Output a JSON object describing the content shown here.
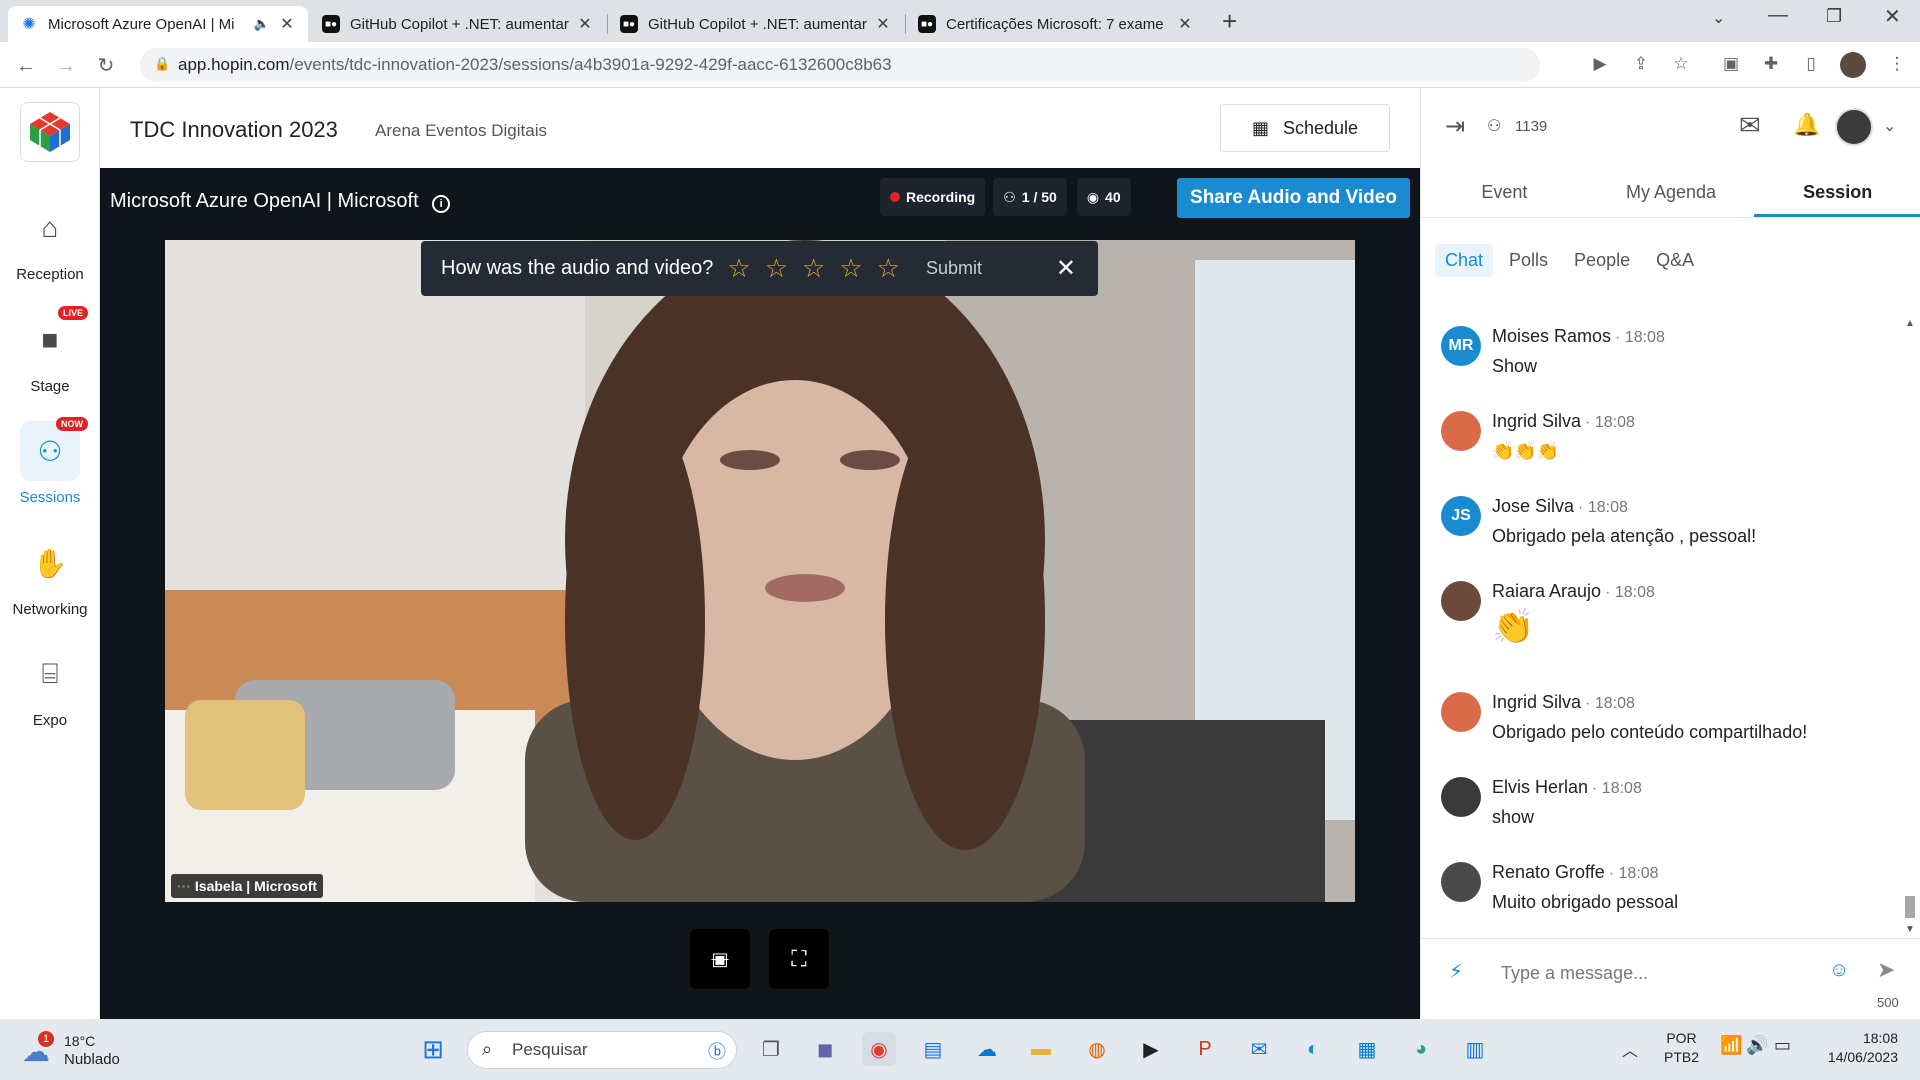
{
  "browser": {
    "tabs": [
      {
        "title": "Microsoft Azure OpenAI | Mi",
        "active": true
      },
      {
        "title": "GitHub Copilot + .NET: aumentar",
        "active": false
      },
      {
        "title": "GitHub Copilot + .NET: aumentar",
        "active": false
      },
      {
        "title": "Certificações Microsoft: 7 exame",
        "active": false
      }
    ],
    "url_host": "app.hopin.com",
    "url_path": "/events/tdc-innovation-2023/sessions/a4b3901a-9292-429f-aacc-6132600c8b63",
    "new_tab_label": "+"
  },
  "nav": {
    "items": [
      {
        "label": "Reception",
        "icon": "home-icon"
      },
      {
        "label": "Stage",
        "icon": "camera-icon",
        "badge": "LIVE"
      },
      {
        "label": "Sessions",
        "icon": "people-icon",
        "badge": "NOW"
      },
      {
        "label": "Networking",
        "icon": "handshake-icon"
      },
      {
        "label": "Expo",
        "icon": "store-icon"
      }
    ]
  },
  "header": {
    "event_title": "TDC Innovation 2023",
    "organizer": "Arena Eventos Digitais",
    "schedule_label": "Schedule"
  },
  "stage": {
    "session_title": "Microsoft Azure OpenAI | Microsoft",
    "recording_label": "Recording",
    "participants": "1 / 50",
    "viewers": "40",
    "share_label": "Share Audio and Video",
    "speaker_name": "Isabela | Microsoft",
    "rating": {
      "question": "How was the audio and video?",
      "stars": 5,
      "submit_label": "Submit"
    }
  },
  "panel": {
    "attendee_count": "1139",
    "main_tabs": [
      "Event",
      "My Agenda",
      "Session"
    ],
    "active_main_tab": "Session",
    "sub_tabs": [
      "Chat",
      "Polls",
      "People",
      "Q&A"
    ],
    "active_sub_tab": "Chat",
    "messages": [
      {
        "name": "Moises Ramos",
        "time": "· 18:08",
        "text": "Show",
        "initials": "MR",
        "color": "#1a8bd1"
      },
      {
        "name": "Ingrid Silva",
        "time": "· 18:08",
        "text": "👏👏👏",
        "initials": "",
        "color": "#d96b4a"
      },
      {
        "name": "Jose Silva",
        "time": "· 18:08",
        "text": "Obrigado pela atenção , pessoal!",
        "initials": "JS",
        "color": "#1a8bd1"
      },
      {
        "name": "Raiara Araujo",
        "time": "· 18:08",
        "text": "👏",
        "initials": "",
        "color": "#6b4a3a"
      },
      {
        "name": "Ingrid Silva",
        "time": "· 18:08",
        "text": "Obrigado pelo conteúdo compartilhado!",
        "initials": "",
        "color": "#d96b4a"
      },
      {
        "name": "Elvis Herlan",
        "time": "· 18:08",
        "text": "show",
        "initials": "",
        "color": "#3a3a3a"
      },
      {
        "name": "Renato Groffe",
        "time": "· 18:08",
        "text": "Muito obrigado pessoal",
        "initials": "",
        "color": "#4a4a4a"
      }
    ],
    "composer_placeholder": "Type a message...",
    "char_limit": "500"
  },
  "taskbar": {
    "weather_temp": "18°C",
    "weather_desc": "Nublado",
    "weather_badge": "1",
    "search_placeholder": "Pesquisar",
    "lang": "POR",
    "layout": "PTB2",
    "time": "18:08",
    "date": "14/06/2023"
  }
}
